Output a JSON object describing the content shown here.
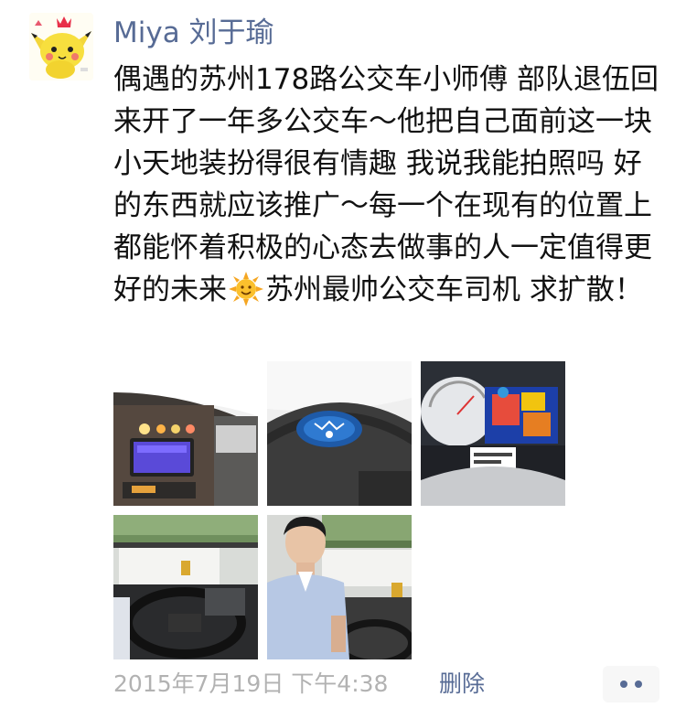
{
  "post": {
    "author": "Miya 刘于瑜",
    "text_before_emoji": "偶遇的苏州178路公交车小师傅 部队退伍回来开了一年多公交车～他把自己面前这一块小天地装扮得很有情趣 我说我能拍照吗 好的东西就应该推广～每一个在现有的位置上都能怀着积极的心态去做事的人一定值得更好的未来",
    "emoji": "sun-emoji",
    "text_after_emoji": "苏州最帅公交车司机 求扩散！",
    "photos": [
      {
        "name": "dashboard-screen-photo"
      },
      {
        "name": "steering-wheel-logo-photo"
      },
      {
        "name": "speedometer-toys-photo"
      },
      {
        "name": "driver-seat-wheel-photo"
      },
      {
        "name": "bus-driver-portrait-photo"
      }
    ],
    "timestamp": "2015年7月19日 下午4:38",
    "delete_label": "删除",
    "more_icon": "more-dots-icon"
  },
  "colors": {
    "link": "#576b95",
    "text": "#111111",
    "meta": "#b2b2b2"
  }
}
